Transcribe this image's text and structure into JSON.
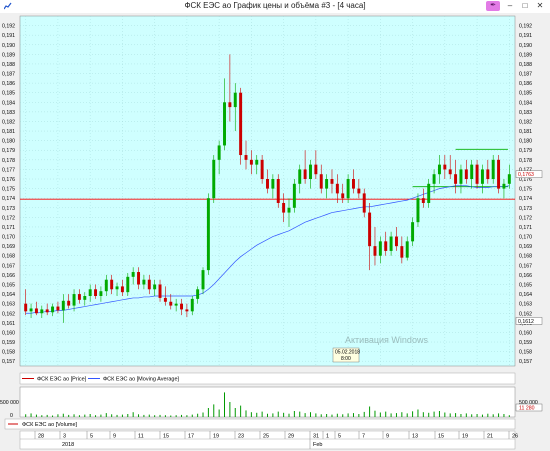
{
  "window": {
    "title": "ФСК ЕЭС ао График цены и объёма #3 - [4 часа]",
    "min_label": "–",
    "max_label": "□",
    "close_label": "✕",
    "pin_icon": "pin-icon",
    "colors": {
      "chart_bg": "#cfffff",
      "up": "#00aa00",
      "down": "#cc0000",
      "ma": "#3355ff",
      "level": "#ff0000"
    }
  },
  "chart_data": [
    {
      "type": "candlestick",
      "title": "",
      "y_ticks": [
        "0,192",
        "0,191",
        "0,190",
        "0,189",
        "0,188",
        "0,187",
        "0,186",
        "0,185",
        "0,184",
        "0,183",
        "0,182",
        "0,181",
        "0,180",
        "0,179",
        "0,178",
        "0,177",
        "0,176",
        "0,175",
        "0,174",
        "0,173",
        "0,172",
        "0,171",
        "0,170",
        "0,169",
        "0,168",
        "0,167",
        "0,166",
        "0,165",
        "0,164",
        "0,163",
        "0,162",
        "0,161",
        "0,160",
        "0,159",
        "0,158",
        "0,157"
      ],
      "ylim": [
        0.1565,
        0.193
      ],
      "horizontal_line": 0.1739,
      "price_tag_right": "0,1763",
      "lower_tag_right": "0,1612",
      "right_extra_ticks": [
        "0,177",
        "0,161"
      ],
      "legend": [
        "ФСК ЕЭС ао [Price]",
        "ФСК ЕЭС ао [Moving Average]"
      ],
      "watermark": "Активация Windows",
      "tooltip": [
        "05.02.2018",
        "8:00"
      ],
      "candles": [
        {
          "o": 0.163,
          "h": 0.1645,
          "l": 0.1618,
          "c": 0.1622
        },
        {
          "o": 0.1622,
          "h": 0.163,
          "l": 0.1615,
          "c": 0.1625
        },
        {
          "o": 0.1625,
          "h": 0.1632,
          "l": 0.1618,
          "c": 0.162
        },
        {
          "o": 0.162,
          "h": 0.1628,
          "l": 0.1615,
          "c": 0.1624
        },
        {
          "o": 0.1624,
          "h": 0.163,
          "l": 0.1618,
          "c": 0.1621
        },
        {
          "o": 0.1621,
          "h": 0.163,
          "l": 0.1617,
          "c": 0.1627
        },
        {
          "o": 0.1627,
          "h": 0.1632,
          "l": 0.162,
          "c": 0.1623
        },
        {
          "o": 0.1623,
          "h": 0.164,
          "l": 0.161,
          "c": 0.1633
        },
        {
          "o": 0.1633,
          "h": 0.164,
          "l": 0.1625,
          "c": 0.1628
        },
        {
          "o": 0.1628,
          "h": 0.1645,
          "l": 0.1622,
          "c": 0.164
        },
        {
          "o": 0.164,
          "h": 0.1645,
          "l": 0.163,
          "c": 0.1634
        },
        {
          "o": 0.1634,
          "h": 0.1642,
          "l": 0.1628,
          "c": 0.1638
        },
        {
          "o": 0.1638,
          "h": 0.165,
          "l": 0.1632,
          "c": 0.1645
        },
        {
          "o": 0.1645,
          "h": 0.165,
          "l": 0.1635,
          "c": 0.1638
        },
        {
          "o": 0.1638,
          "h": 0.1648,
          "l": 0.1632,
          "c": 0.1643
        },
        {
          "o": 0.1643,
          "h": 0.166,
          "l": 0.1638,
          "c": 0.1655
        },
        {
          "o": 0.1655,
          "h": 0.166,
          "l": 0.164,
          "c": 0.1645
        },
        {
          "o": 0.1645,
          "h": 0.1652,
          "l": 0.1638,
          "c": 0.1648
        },
        {
          "o": 0.1648,
          "h": 0.1655,
          "l": 0.1638,
          "c": 0.1642
        },
        {
          "o": 0.1642,
          "h": 0.1662,
          "l": 0.1638,
          "c": 0.1658
        },
        {
          "o": 0.1658,
          "h": 0.1668,
          "l": 0.165,
          "c": 0.1663
        },
        {
          "o": 0.1663,
          "h": 0.1668,
          "l": 0.1645,
          "c": 0.165
        },
        {
          "o": 0.165,
          "h": 0.166,
          "l": 0.1645,
          "c": 0.1655
        },
        {
          "o": 0.1655,
          "h": 0.166,
          "l": 0.164,
          "c": 0.1645
        },
        {
          "o": 0.1645,
          "h": 0.1655,
          "l": 0.1638,
          "c": 0.165
        },
        {
          "o": 0.165,
          "h": 0.1655,
          "l": 0.1632,
          "c": 0.1636
        },
        {
          "o": 0.1636,
          "h": 0.1648,
          "l": 0.1628,
          "c": 0.1632
        },
        {
          "o": 0.1632,
          "h": 0.164,
          "l": 0.1624,
          "c": 0.1628
        },
        {
          "o": 0.1628,
          "h": 0.1635,
          "l": 0.1622,
          "c": 0.163
        },
        {
          "o": 0.163,
          "h": 0.1635,
          "l": 0.1618,
          "c": 0.1624
        },
        {
          "o": 0.1624,
          "h": 0.163,
          "l": 0.1616,
          "c": 0.1622
        },
        {
          "o": 0.1622,
          "h": 0.1638,
          "l": 0.1618,
          "c": 0.1635
        },
        {
          "o": 0.1635,
          "h": 0.1648,
          "l": 0.163,
          "c": 0.1645
        },
        {
          "o": 0.1645,
          "h": 0.1668,
          "l": 0.164,
          "c": 0.1665
        },
        {
          "o": 0.1665,
          "h": 0.1745,
          "l": 0.166,
          "c": 0.174
        },
        {
          "o": 0.174,
          "h": 0.1785,
          "l": 0.1735,
          "c": 0.178
        },
        {
          "o": 0.178,
          "h": 0.18,
          "l": 0.1765,
          "c": 0.1795
        },
        {
          "o": 0.1795,
          "h": 0.1865,
          "l": 0.179,
          "c": 0.184
        },
        {
          "o": 0.184,
          "h": 0.189,
          "l": 0.182,
          "c": 0.1835
        },
        {
          "o": 0.1835,
          "h": 0.186,
          "l": 0.181,
          "c": 0.185
        },
        {
          "o": 0.185,
          "h": 0.1855,
          "l": 0.1775,
          "c": 0.1785
        },
        {
          "o": 0.1785,
          "h": 0.18,
          "l": 0.177,
          "c": 0.178
        },
        {
          "o": 0.178,
          "h": 0.179,
          "l": 0.1765,
          "c": 0.1775
        },
        {
          "o": 0.1775,
          "h": 0.1785,
          "l": 0.1765,
          "c": 0.178
        },
        {
          "o": 0.178,
          "h": 0.1785,
          "l": 0.1755,
          "c": 0.176
        },
        {
          "o": 0.176,
          "h": 0.177,
          "l": 0.1745,
          "c": 0.175
        },
        {
          "o": 0.175,
          "h": 0.1765,
          "l": 0.174,
          "c": 0.176
        },
        {
          "o": 0.176,
          "h": 0.1765,
          "l": 0.173,
          "c": 0.1735
        },
        {
          "o": 0.1735,
          "h": 0.1745,
          "l": 0.1715,
          "c": 0.1725
        },
        {
          "o": 0.1725,
          "h": 0.174,
          "l": 0.171,
          "c": 0.173
        },
        {
          "o": 0.173,
          "h": 0.176,
          "l": 0.1725,
          "c": 0.1755
        },
        {
          "o": 0.1755,
          "h": 0.1775,
          "l": 0.1745,
          "c": 0.177
        },
        {
          "o": 0.177,
          "h": 0.179,
          "l": 0.1755,
          "c": 0.176
        },
        {
          "o": 0.176,
          "h": 0.178,
          "l": 0.175,
          "c": 0.1775
        },
        {
          "o": 0.1775,
          "h": 0.179,
          "l": 0.176,
          "c": 0.1765
        },
        {
          "o": 0.1765,
          "h": 0.1775,
          "l": 0.1745,
          "c": 0.175
        },
        {
          "o": 0.175,
          "h": 0.1765,
          "l": 0.174,
          "c": 0.176
        },
        {
          "o": 0.176,
          "h": 0.177,
          "l": 0.1745,
          "c": 0.1755
        },
        {
          "o": 0.1755,
          "h": 0.1765,
          "l": 0.1735,
          "c": 0.1745
        },
        {
          "o": 0.1745,
          "h": 0.1755,
          "l": 0.1735,
          "c": 0.174
        },
        {
          "o": 0.174,
          "h": 0.1765,
          "l": 0.1735,
          "c": 0.176
        },
        {
          "o": 0.176,
          "h": 0.177,
          "l": 0.1745,
          "c": 0.175
        },
        {
          "o": 0.175,
          "h": 0.176,
          "l": 0.174,
          "c": 0.1745
        },
        {
          "o": 0.1745,
          "h": 0.175,
          "l": 0.172,
          "c": 0.1725
        },
        {
          "o": 0.1725,
          "h": 0.1735,
          "l": 0.1665,
          "c": 0.169
        },
        {
          "o": 0.169,
          "h": 0.171,
          "l": 0.167,
          "c": 0.168
        },
        {
          "o": 0.168,
          "h": 0.17,
          "l": 0.1672,
          "c": 0.1695
        },
        {
          "o": 0.1695,
          "h": 0.1705,
          "l": 0.168,
          "c": 0.1685
        },
        {
          "o": 0.1685,
          "h": 0.1705,
          "l": 0.168,
          "c": 0.17
        },
        {
          "o": 0.17,
          "h": 0.171,
          "l": 0.1685,
          "c": 0.169
        },
        {
          "o": 0.169,
          "h": 0.17,
          "l": 0.1672,
          "c": 0.1678
        },
        {
          "o": 0.1678,
          "h": 0.17,
          "l": 0.1675,
          "c": 0.1695
        },
        {
          "o": 0.1695,
          "h": 0.172,
          "l": 0.169,
          "c": 0.1715
        },
        {
          "o": 0.1715,
          "h": 0.1745,
          "l": 0.171,
          "c": 0.174
        },
        {
          "o": 0.174,
          "h": 0.175,
          "l": 0.173,
          "c": 0.1735
        },
        {
          "o": 0.1735,
          "h": 0.176,
          "l": 0.173,
          "c": 0.1755
        },
        {
          "o": 0.1755,
          "h": 0.177,
          "l": 0.1745,
          "c": 0.1765
        },
        {
          "o": 0.1765,
          "h": 0.1785,
          "l": 0.1755,
          "c": 0.1775
        },
        {
          "o": 0.1775,
          "h": 0.1785,
          "l": 0.176,
          "c": 0.177
        },
        {
          "o": 0.177,
          "h": 0.1785,
          "l": 0.176,
          "c": 0.1765
        },
        {
          "o": 0.1765,
          "h": 0.178,
          "l": 0.1745,
          "c": 0.1755
        },
        {
          "o": 0.1755,
          "h": 0.1775,
          "l": 0.1745,
          "c": 0.177
        },
        {
          "o": 0.177,
          "h": 0.178,
          "l": 0.1755,
          "c": 0.176
        },
        {
          "o": 0.176,
          "h": 0.178,
          "l": 0.175,
          "c": 0.1775
        },
        {
          "o": 0.1775,
          "h": 0.178,
          "l": 0.175,
          "c": 0.1755
        },
        {
          "o": 0.1755,
          "h": 0.1775,
          "l": 0.1745,
          "c": 0.177
        },
        {
          "o": 0.177,
          "h": 0.178,
          "l": 0.1755,
          "c": 0.176
        },
        {
          "o": 0.176,
          "h": 0.1785,
          "l": 0.1755,
          "c": 0.178
        },
        {
          "o": 0.178,
          "h": 0.1785,
          "l": 0.1745,
          "c": 0.175
        },
        {
          "o": 0.175,
          "h": 0.176,
          "l": 0.174,
          "c": 0.1755
        },
        {
          "o": 0.1755,
          "h": 0.1775,
          "l": 0.175,
          "c": 0.1765
        }
      ],
      "moving_average": [
        0.162,
        0.162,
        0.1621,
        0.1621,
        0.1622,
        0.1622,
        0.1623,
        0.1623,
        0.1624,
        0.1625,
        0.1626,
        0.1627,
        0.1628,
        0.1629,
        0.163,
        0.1631,
        0.1632,
        0.1633,
        0.1634,
        0.1635,
        0.1636,
        0.1636,
        0.1637,
        0.1637,
        0.1638,
        0.1638,
        0.1638,
        0.1638,
        0.1638,
        0.1638,
        0.1638,
        0.1638,
        0.1639,
        0.1641,
        0.1645,
        0.165,
        0.1656,
        0.1662,
        0.1668,
        0.1674,
        0.1679,
        0.1683,
        0.1687,
        0.1691,
        0.1694,
        0.1697,
        0.17,
        0.1702,
        0.1704,
        0.1706,
        0.1709,
        0.1712,
        0.1715,
        0.1717,
        0.1719,
        0.1721,
        0.1723,
        0.1725,
        0.1726,
        0.1727,
        0.1728,
        0.1729,
        0.173,
        0.1731,
        0.1731,
        0.1732,
        0.1733,
        0.1734,
        0.1735,
        0.1736,
        0.1737,
        0.1738,
        0.174,
        0.1742,
        0.1744,
        0.1746,
        0.1748,
        0.175,
        0.1751,
        0.1752,
        0.1753,
        0.1753,
        0.1753,
        0.1752,
        0.1751,
        0.1751,
        0.1751,
        0.1752,
        0.1752,
        0.1752,
        0.1753
      ],
      "channel_top": [
        {
          "i": 80,
          "v": 0.1791
        },
        {
          "i": 89,
          "v": 0.1791
        }
      ],
      "channel_bottom": [
        {
          "i": 72,
          "v": 0.1752
        },
        {
          "i": 89,
          "v": 0.1752
        }
      ]
    },
    {
      "type": "bar",
      "title": "",
      "y_ticks": [
        "500 000",
        "0"
      ],
      "right_tag": "11 280",
      "legend": [
        "ФСК ЕЭС ао [Volume]"
      ],
      "ylim": [
        0,
        1000000
      ],
      "values": [
        90000,
        120000,
        80000,
        60000,
        70000,
        50000,
        90000,
        110000,
        70000,
        90000,
        60000,
        80000,
        100000,
        60000,
        80000,
        130000,
        90000,
        70000,
        80000,
        100000,
        160000,
        90000,
        70000,
        80000,
        60000,
        70000,
        60000,
        50000,
        60000,
        70000,
        60000,
        80000,
        110000,
        150000,
        300000,
        420000,
        250000,
        820000,
        500000,
        300000,
        380000,
        220000,
        160000,
        140000,
        180000,
        110000,
        120000,
        180000,
        140000,
        110000,
        200000,
        180000,
        130000,
        160000,
        120000,
        90000,
        100000,
        80000,
        110000,
        90000,
        120000,
        130000,
        100000,
        170000,
        350000,
        210000,
        150000,
        180000,
        120000,
        130000,
        160000,
        120000,
        190000,
        250000,
        160000,
        140000,
        180000,
        200000,
        150000,
        120000,
        130000,
        100000,
        120000,
        90000,
        100000,
        80000,
        110000,
        90000,
        120000,
        100000,
        60000
      ]
    }
  ],
  "x_axis": {
    "days": [
      "28",
      "3",
      "5",
      "9",
      "11",
      "15",
      "17",
      "19",
      "23",
      "25",
      "29",
      "31",
      "1",
      "5",
      "7",
      "9",
      "13",
      "15",
      "19",
      "21",
      "26"
    ],
    "months": [
      {
        "label": "2018"
      },
      {
        "label": "Feb"
      }
    ]
  }
}
